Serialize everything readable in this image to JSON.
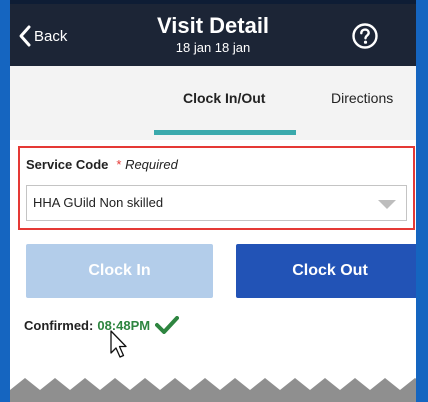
{
  "header": {
    "back_label": "Back",
    "title": "Visit Detail",
    "subtitle": "18 jan 18 jan",
    "help_icon": "question-circle-icon",
    "background": "#1c2536"
  },
  "tabs": [
    {
      "label": "Clock In/Out",
      "active": true
    },
    {
      "label": "Directions",
      "active": false
    }
  ],
  "tab_indicator_color": "#3aa9ac",
  "service": {
    "label": "Service Code",
    "required_marker": "*",
    "required_text": "Required",
    "selected_value": "HHA GUild Non skilled",
    "highlight_color": "#e53935"
  },
  "buttons": {
    "clock_in": "Clock In",
    "clock_out": "Clock Out",
    "clock_in_enabled": false,
    "clock_in_color": "#b3cdea",
    "clock_out_color": "#2253b6"
  },
  "status": {
    "label": "Confirmed:",
    "time": "08:48PM",
    "icon": "checkmark-icon",
    "time_color": "#2e8540"
  }
}
